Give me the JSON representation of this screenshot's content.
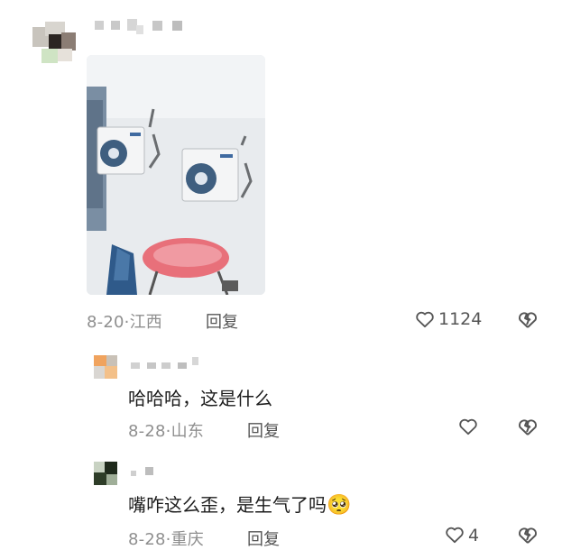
{
  "main_comment": {
    "date": "8-20",
    "location": "江西",
    "reply_label": "回复",
    "like_count": "1124"
  },
  "replies": [
    {
      "text": "哈哈哈，这是什么",
      "date": "8-28",
      "location": "山东",
      "reply_label": "回复",
      "like_count": ""
    },
    {
      "text": "嘴咋这么歪，是生气了吗",
      "emoji": "🥺",
      "date": "8-28",
      "location": "重庆",
      "reply_label": "回复",
      "like_count": "4"
    }
  ],
  "icons": {
    "like": "heart-outline-icon",
    "dislike": "broken-heart-icon",
    "separator": "·"
  },
  "colors": {
    "meta_gray": "#8f8f8f",
    "text": "#1c1c1c",
    "photo_wall": "#e9ecef",
    "chair_red": "#e8707a"
  }
}
